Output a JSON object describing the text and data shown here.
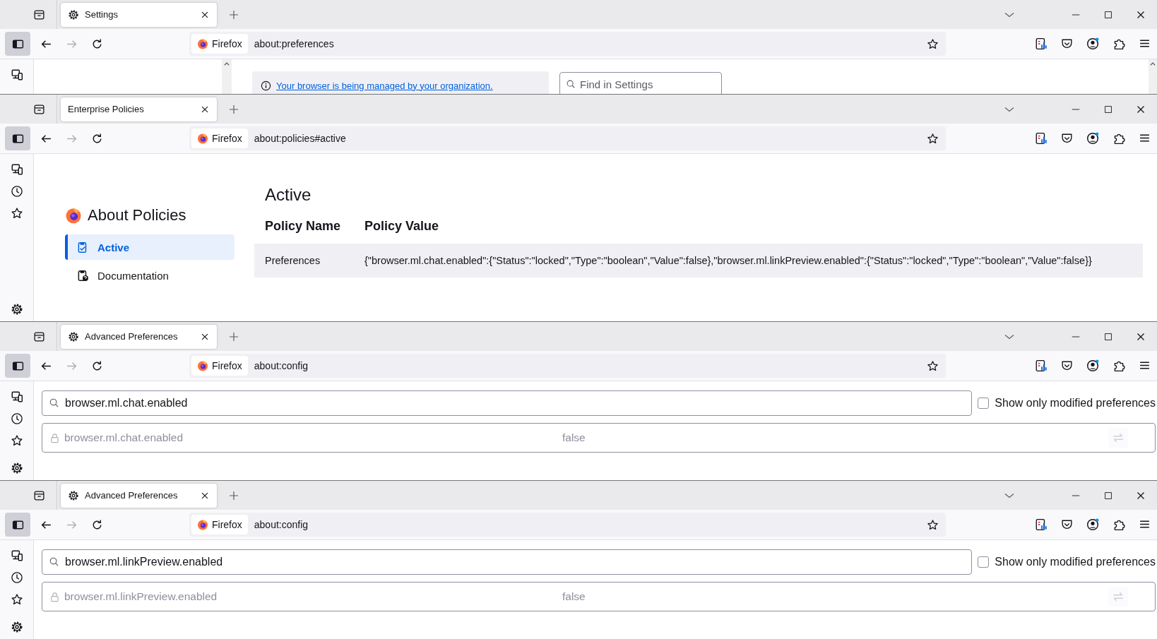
{
  "windows": [
    {
      "kind": "preferences",
      "tab": {
        "title": "Settings"
      },
      "identity": "Firefox",
      "url": "about:preferences",
      "content": {
        "notice_link": "Your browser is being managed by your organization.",
        "search": {
          "placeholder": "Find in Settings"
        }
      }
    },
    {
      "kind": "policies",
      "tab": {
        "title": "Enterprise Policies"
      },
      "identity": "Firefox",
      "url": "about:policies#active",
      "content": {
        "title": "About Policies",
        "nav": [
          {
            "label": "Active",
            "selected": true
          },
          {
            "label": "Documentation",
            "selected": false
          }
        ],
        "heading": "Active",
        "table": {
          "columns": [
            "Policy Name",
            "Policy Value"
          ],
          "rows": [
            [
              "Preferences",
              "{\"browser.ml.chat.enabled\":{\"Status\":\"locked\",\"Type\":\"boolean\",\"Value\":false},\"browser.ml.linkPreview.enabled\":{\"Status\":\"locked\",\"Type\":\"boolean\",\"Value\":false}}"
            ]
          ]
        }
      }
    },
    {
      "kind": "config",
      "tab": {
        "title": "Advanced Preferences"
      },
      "identity": "Firefox",
      "url": "about:config",
      "content": {
        "search": {
          "value": "browser.ml.chat.enabled"
        },
        "checkbox": {
          "label": "Show only modified preferences",
          "checked": false
        },
        "rows": [
          {
            "name": "browser.ml.chat.enabled",
            "value": "false",
            "locked": true
          }
        ]
      }
    },
    {
      "kind": "config",
      "tab": {
        "title": "Advanced Preferences"
      },
      "identity": "Firefox",
      "url": "about:config",
      "content": {
        "search": {
          "value": "browser.ml.linkPreview.enabled"
        },
        "checkbox": {
          "label": "Show only modified preferences",
          "checked": false
        },
        "rows": [
          {
            "name": "browser.ml.linkPreview.enabled",
            "value": "false",
            "locked": true
          }
        ]
      }
    }
  ]
}
